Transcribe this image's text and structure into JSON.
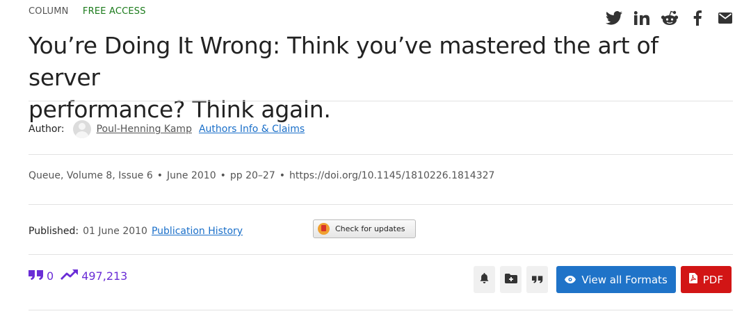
{
  "article": {
    "type": "COLUMN",
    "access": "FREE ACCESS",
    "title_line1": "You’re Doing It Wrong: Think you’ve mastered the art of server",
    "title_line2": "performance? Think again."
  },
  "share": {
    "icons": [
      "twitter-icon",
      "linkedin-icon",
      "reddit-icon",
      "facebook-icon",
      "email-icon"
    ]
  },
  "author": {
    "label": "Author:",
    "name": "Poul-Henning Kamp",
    "info_link": "Authors Info & Claims"
  },
  "citation": {
    "source": "Queue, Volume 8, Issue 6",
    "date": "June 2010",
    "pages": "pp 20–27",
    "doi": "https://doi.org/10.1145/1810226.1814327",
    "separator": "•"
  },
  "publication": {
    "label": "Published:",
    "date": "01 June 2010",
    "history_link": "Publication History",
    "check_updates": "Check for updates"
  },
  "metrics": {
    "citations": "0",
    "downloads": "497,213",
    "color": "#6a2dd6"
  },
  "actions": {
    "view_formats": "View all Formats",
    "pdf": "PDF",
    "view_color": "#1f73c8",
    "pdf_color": "#d21515"
  }
}
